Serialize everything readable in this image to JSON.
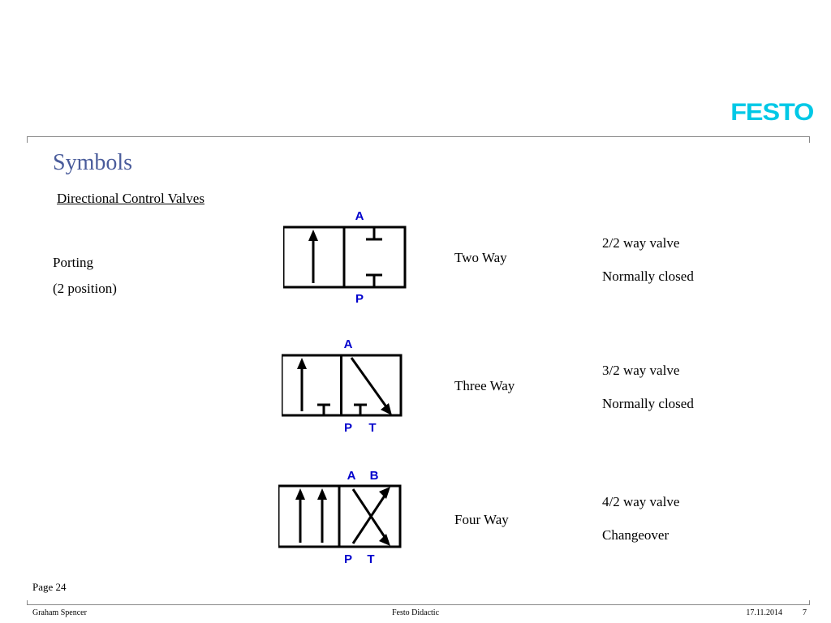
{
  "brand": "FESTO",
  "title": "Symbols",
  "subtitle": "Directional Control Valves",
  "porting": {
    "line1": "Porting",
    "line2": "(2 position)"
  },
  "valves": [
    {
      "name": "Two Way",
      "spec": "2/2 way valve",
      "state": "Normally closed",
      "ports_top": [
        "A"
      ],
      "ports_bottom": [
        "P"
      ]
    },
    {
      "name": "Three Way",
      "spec": "3/2 way valve",
      "state": "Normally closed",
      "ports_top": [
        "A"
      ],
      "ports_bottom": [
        "P",
        "T"
      ]
    },
    {
      "name": "Four Way",
      "spec": "4/2 way valve",
      "state": "Changeover",
      "ports_top": [
        "A",
        "B"
      ],
      "ports_bottom": [
        "P",
        "T"
      ]
    }
  ],
  "footer": {
    "page": "Page 24",
    "author": "Graham Spencer",
    "org": "Festo Didactic",
    "date": "17.11.2014",
    "slide": "7"
  }
}
